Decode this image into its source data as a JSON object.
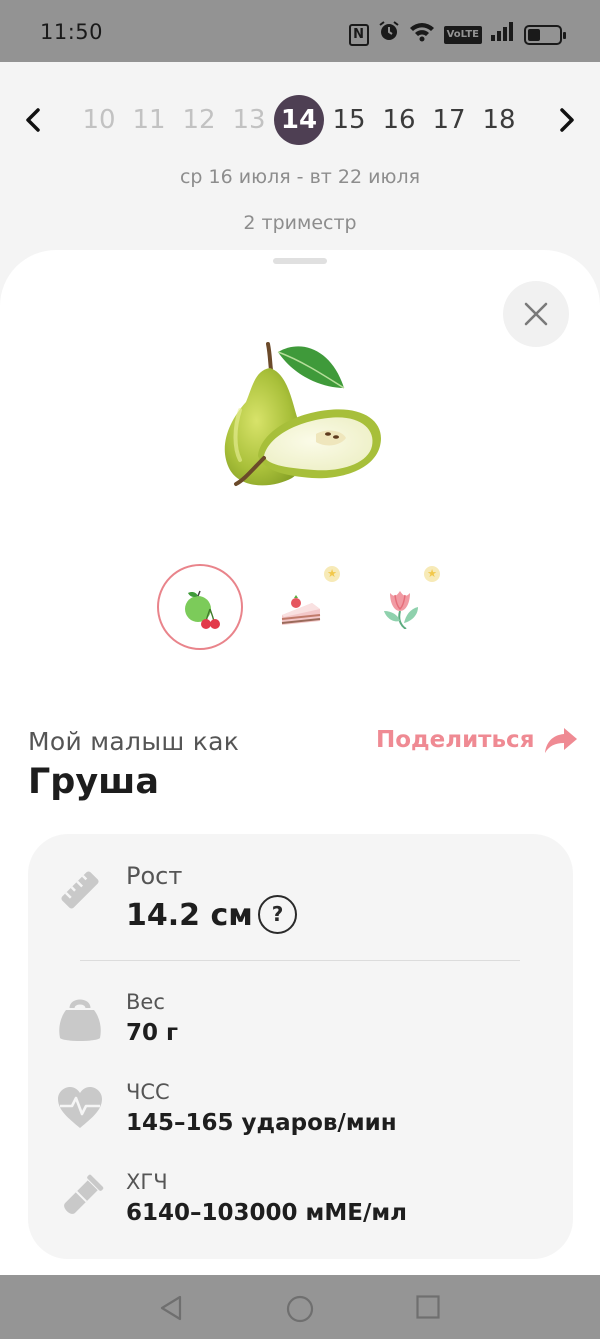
{
  "status_bar": {
    "time": "11:50",
    "icons": [
      "nfc-icon",
      "alarm-icon",
      "wifi-icon",
      "volte-icon",
      "signal-icon",
      "battery-icon"
    ],
    "nfc_label": "N",
    "volte_label": "VoLTE"
  },
  "week_nav": {
    "weeks": [
      {
        "label": "10",
        "state": "past"
      },
      {
        "label": "11",
        "state": "past"
      },
      {
        "label": "12",
        "state": "past"
      },
      {
        "label": "13",
        "state": "past"
      },
      {
        "label": "14",
        "state": "active"
      },
      {
        "label": "15",
        "state": "future"
      },
      {
        "label": "16",
        "state": "future"
      },
      {
        "label": "17",
        "state": "future"
      },
      {
        "label": "18",
        "state": "future"
      }
    ],
    "prev_icon": "chevron-left-icon",
    "next_icon": "chevron-right-icon",
    "range": "ср 16 июля - вт 22 июля",
    "trimester": "2 триместр"
  },
  "sheet": {
    "close_icon": "close-icon",
    "hero_icon": "pear-icon",
    "comparisons": [
      {
        "icon": "fruit-icon",
        "selected": true,
        "locked_star": false
      },
      {
        "icon": "cake-icon",
        "selected": false,
        "locked_star": true
      },
      {
        "icon": "flower-icon",
        "selected": false,
        "locked_star": true
      }
    ],
    "compare_label": "Мой малыш как",
    "fruit_name": "Груша",
    "share_label": "Поделиться",
    "share_icon": "share-arrow-icon"
  },
  "stats": {
    "height": {
      "label": "Рост",
      "value": "14.2 см",
      "help": "?",
      "icon": "ruler-icon"
    },
    "weight": {
      "label": "Вес",
      "value": "70 г",
      "icon": "weight-icon"
    },
    "heart_rate": {
      "label": "ЧСС",
      "value": "145–165 ударов/мин",
      "icon": "heart-pulse-icon"
    },
    "hcg": {
      "label": "ХГЧ",
      "value": "6140–103000 мМЕ/мл",
      "icon": "test-tube-icon"
    }
  },
  "nav_bar": {
    "buttons": [
      "back-icon",
      "home-icon",
      "recents-icon"
    ]
  },
  "colors": {
    "accent": "#ef8a93",
    "active_week": "#4e3f53",
    "card_bg": "#f5f5f5",
    "status_bar_bg": "#939393"
  }
}
